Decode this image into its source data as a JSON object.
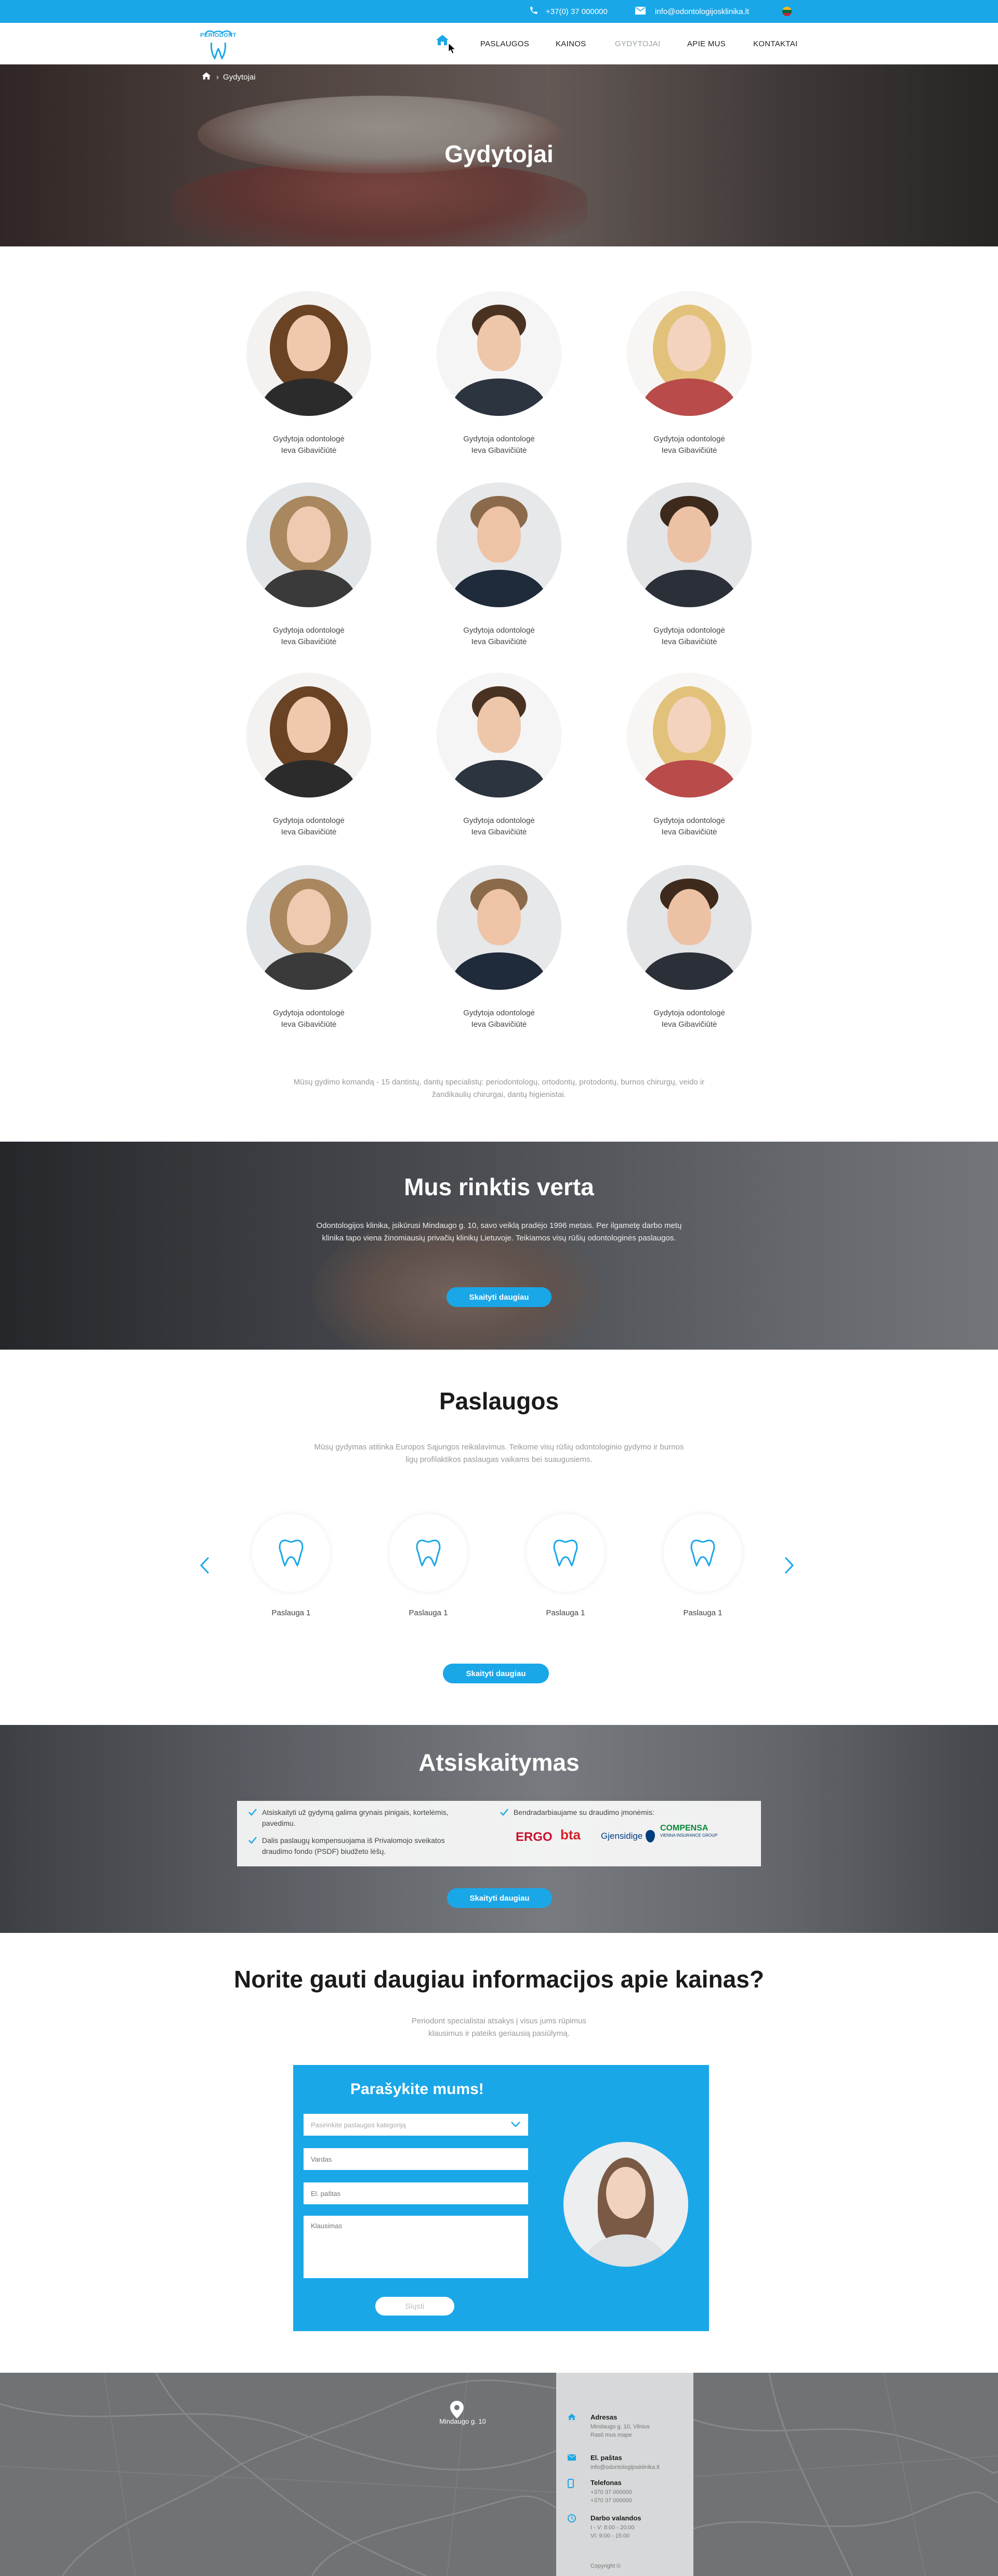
{
  "topbar": {
    "phone": "+37(0) 37 000000",
    "email": "info@odontologijosklinika.lt"
  },
  "header": {
    "logo_text": "PERIODONT",
    "nav": [
      "PASLAUGOS",
      "KAINOS",
      "GYDYTOJAI",
      "APIE MUS",
      "KONTAKTAI"
    ]
  },
  "hero": {
    "title": "Gydytojai",
    "breadcrumb": "Gydytojai"
  },
  "doctors": [
    {
      "role": "Gydytoja odontologė",
      "name": "Ieva Gibavičiūtė"
    },
    {
      "role": "Gydytoja odontologė",
      "name": "Ieva Gibavičiūtė"
    },
    {
      "role": "Gydytoja odontologė",
      "name": "Ieva Gibavičiūtė"
    },
    {
      "role": "Gydytoja odontologė",
      "name": "Ieva Gibavičiūtė"
    },
    {
      "role": "Gydytoja odontologė",
      "name": "Ieva Gibavičiūtė"
    },
    {
      "role": "Gydytoja odontologė",
      "name": "Ieva Gibavičiūtė"
    },
    {
      "role": "Gydytoja odontologė",
      "name": "Ieva Gibavičiūtė"
    },
    {
      "role": "Gydytoja odontologė",
      "name": "Ieva Gibavičiūtė"
    },
    {
      "role": "Gydytoja odontologė",
      "name": "Ieva Gibavičiūtė"
    },
    {
      "role": "Gydytoja odontologė",
      "name": "Ieva Gibavičiūtė"
    },
    {
      "role": "Gydytoja odontologė",
      "name": "Ieva Gibavičiūtė"
    },
    {
      "role": "Gydytoja odontologė",
      "name": "Ieva Gibavičiūtė"
    }
  ],
  "team_text": "Mūsų gydimo komandą - 15 dantistų, dantų specialistų: periodontologų, ortodontų, protodontų, burnos chirurgų, veido ir žandikaulių chirurgai, dantų higienistai.",
  "why": {
    "title": "Mus rinktis verta",
    "text": "Odontologijos klinika, įsikūrusi Mindaugo g. 10, savo veiklą pradėjo 1996 metais. Per ilgametę darbo metų klinika tapo viena žinomiausių privačių klinikų Lietuvoje. Teikiamos visų rūšių odontologinės paslaugos.",
    "button": "Skaityti daugiau"
  },
  "services": {
    "title": "Paslaugos",
    "text": "Mūsų gydymas atitinka Europos Sąjungos reikalavimus. Teikome visų rūšių odontologinio gydymo ir burnos ligų profilaktikos paslaugas vaikams bei suaugusiems.",
    "items": [
      "Paslauga 1",
      "Paslauga 1",
      "Paslauga 1",
      "Paslauga 1"
    ],
    "button": "Skaityti daugiau"
  },
  "payments": {
    "title": "Atsiskaitymas",
    "items": [
      "Atsiskaityti už gydymą galima grynais pinigais, kortelėmis, pavedimu.",
      "Dalis paslaugų kompensuojama iš Privalomojo sveikatos draudimo fondo (PSDF) biudžeto lėšų.",
      "Bendradarbiaujame su draudimo įmonėmis:"
    ],
    "partners": [
      "ERGO",
      "bta",
      "Gjensidige",
      "COMPENSA"
    ],
    "partner_colors": {
      "ERGO": "#c8102e",
      "bta": "#d2232a",
      "Gjensidige": "#003e7e",
      "COMPENSA": "#0a8a3a"
    },
    "compensa_sub": "VIENNA INSURANCE GROUP",
    "button": "Skaityti daugiau"
  },
  "info": {
    "title": "Norite gauti daugiau informacijos apie kainas?",
    "text": "Periodont specialistai atsakys į visus jums rūpimus klausimus ir pateiks geriausią pasiūlymą.",
    "form": {
      "title": "Parašykite mums!",
      "select_placeholder": "Pasirinkite paslaugos kategoriją",
      "name_placeholder": "Vardas",
      "email_placeholder": "El. paštas",
      "message_placeholder": "Klausimas",
      "submit": "Siųsti"
    }
  },
  "contacts": {
    "map_marker": "Mindaugo g. 10",
    "address_label": "Adresas",
    "address_value": "Mindaugo g. 10, Vilnius",
    "address_extra": "Rasti mus mape",
    "email_label": "El. paštas",
    "email_value": "info@odontologijosklinika.lt",
    "phone_label": "Telefonas",
    "phone_value": "+370 37 000000",
    "phone_value2": "+370 37 000000",
    "hours_label": "Darbo valandos",
    "hours_value": "I - V: 8:00 - 20:00",
    "hours_value2": "VI: 9:00 - 15:00",
    "copyright": "Copyright ©"
  },
  "colors": {
    "accent": "#1aa7e8"
  }
}
